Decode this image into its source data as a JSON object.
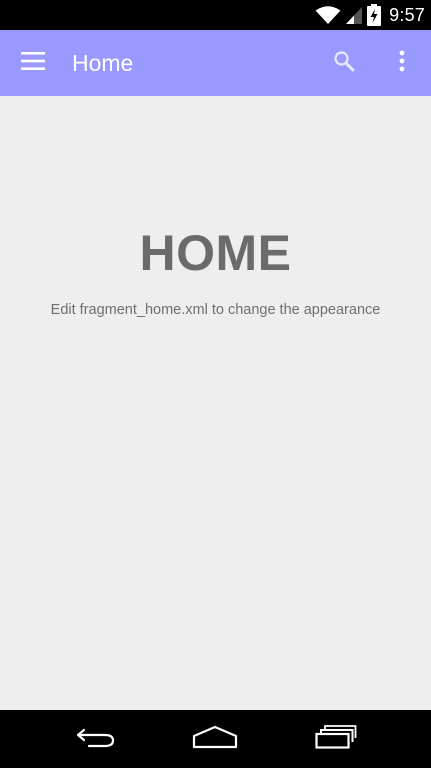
{
  "status_bar": {
    "time": "9:57",
    "icons": [
      "wifi-icon",
      "cell-signal-icon",
      "battery-charging-icon"
    ]
  },
  "app_bar": {
    "title": "Home",
    "background_color": "#9999ff",
    "menu_icon": "hamburger-menu-icon",
    "actions": [
      "search-icon",
      "overflow-menu-icon"
    ]
  },
  "content": {
    "heading": "HOME",
    "subtext": "Edit fragment_home.xml to change the appearance"
  },
  "nav_bar": {
    "buttons": [
      "back-icon",
      "home-icon",
      "recents-icon"
    ]
  }
}
